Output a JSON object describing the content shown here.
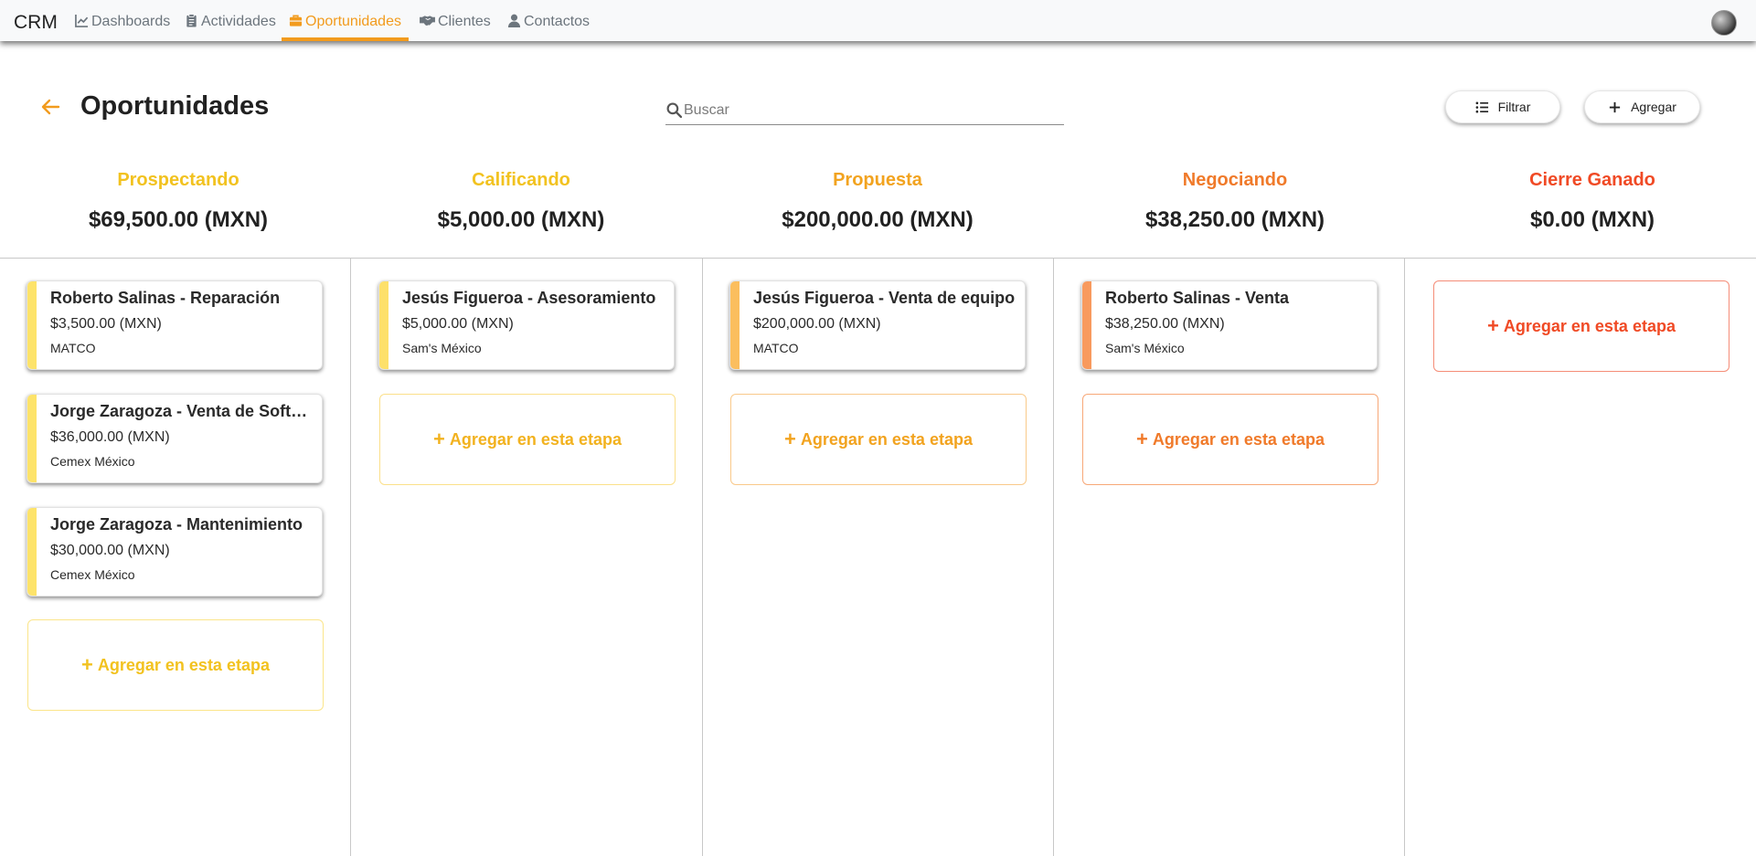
{
  "app": {
    "brand": "CRM"
  },
  "nav": {
    "items": [
      {
        "label": "Dashboards",
        "icon": "chart-line-icon"
      },
      {
        "label": "Actividades",
        "icon": "clipboard-icon"
      },
      {
        "label": "Oportunidades",
        "icon": "briefcase-icon",
        "active": true
      },
      {
        "label": "Clientes",
        "icon": "handshake-icon"
      },
      {
        "label": "Contactos",
        "icon": "user-icon"
      }
    ]
  },
  "header": {
    "title": "Oportunidades",
    "search_placeholder": "Buscar",
    "filter_label": "Filtrar",
    "add_label": "Agregar"
  },
  "colors": {
    "accent": "#f29b1d",
    "stage_prospectando": "#f2c21f",
    "stage_calificando": "#f2c21f",
    "stage_propuesta": "#f2a31f",
    "stage_negociando": "#f07a2a",
    "stage_cierre": "#f04a25"
  },
  "add_in_stage_label": "Agregar en esta etapa",
  "stages": [
    {
      "name": "Prospectando",
      "total": "$69,500.00 (MXN)",
      "cards": [
        {
          "title": "Roberto Salinas - Reparación",
          "amount": "$3,500.00 (MXN)",
          "company": "MATCO"
        },
        {
          "title": "Jorge Zaragoza - Venta de Software",
          "amount": "$36,000.00 (MXN)",
          "company": "Cemex México"
        },
        {
          "title": "Jorge Zaragoza - Mantenimiento",
          "amount": "$30,000.00 (MXN)",
          "company": "Cemex México"
        }
      ]
    },
    {
      "name": "Calificando",
      "total": "$5,000.00 (MXN)",
      "cards": [
        {
          "title": "Jesús Figueroa - Asesoramiento",
          "amount": "$5,000.00 (MXN)",
          "company": "Sam's México"
        }
      ]
    },
    {
      "name": "Propuesta",
      "total": "$200,000.00 (MXN)",
      "cards": [
        {
          "title": "Jesús Figueroa - Venta de equipo",
          "amount": "$200,000.00 (MXN)",
          "company": "MATCO"
        }
      ]
    },
    {
      "name": "Negociando",
      "total": "$38,250.00 (MXN)",
      "cards": [
        {
          "title": "Roberto Salinas - Venta",
          "amount": "$38,250.00 (MXN)",
          "company": "Sam's México"
        }
      ]
    },
    {
      "name": "Cierre Ganado",
      "total": "$0.00 (MXN)",
      "cards": []
    }
  ]
}
